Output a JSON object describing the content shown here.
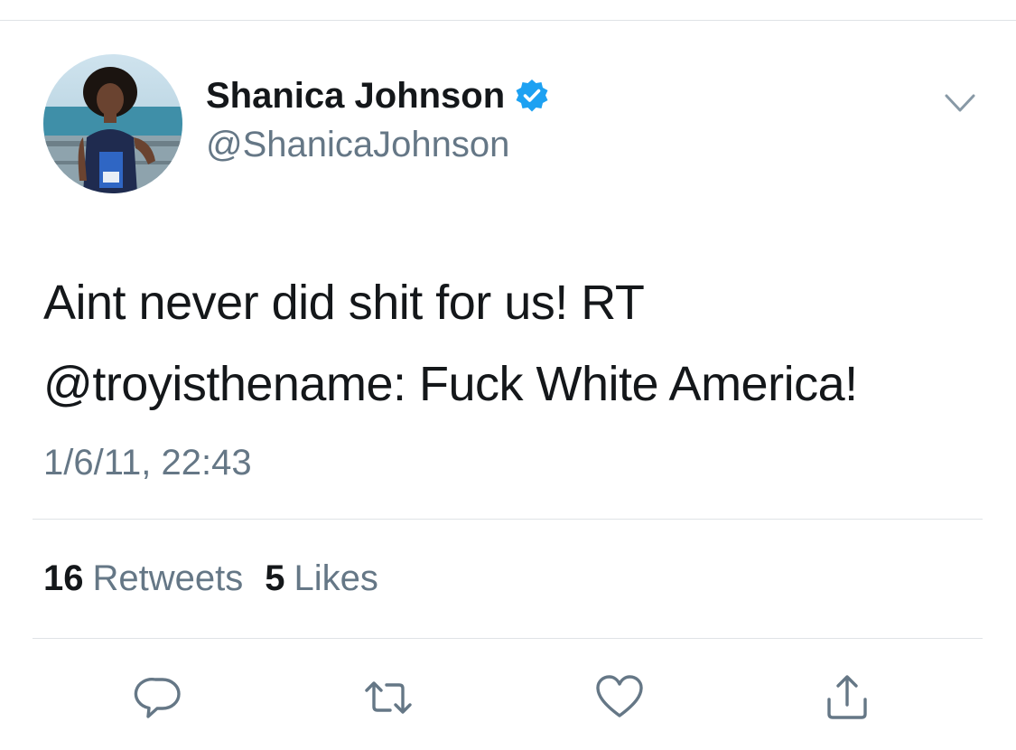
{
  "tweet": {
    "author": {
      "display_name": "Shanica Johnson",
      "handle": "@ShanicaJohnson",
      "verified": true,
      "verified_color": "#1DA1F2",
      "avatar_icon": "profile-photo"
    },
    "text_lines": [
      "Aint never did shit for us! RT",
      "@troyisthename: Fuck White America!"
    ],
    "timestamp": "1/6/11, 22:43",
    "stats": {
      "retweets_count": "16",
      "retweets_label": "Retweets",
      "likes_count": "5",
      "likes_label": "Likes"
    },
    "actions": [
      {
        "name": "reply",
        "icon": "speech-bubble-icon"
      },
      {
        "name": "retweet",
        "icon": "retweet-arrows-icon"
      },
      {
        "name": "like",
        "icon": "heart-icon"
      },
      {
        "name": "share",
        "icon": "share-upload-icon"
      }
    ],
    "menu_icon": "chevron-down-icon"
  },
  "colors": {
    "primary_text": "#14171A",
    "secondary_text": "#657786",
    "divider": "#DFE3E6",
    "accent": "#1DA1F2"
  }
}
